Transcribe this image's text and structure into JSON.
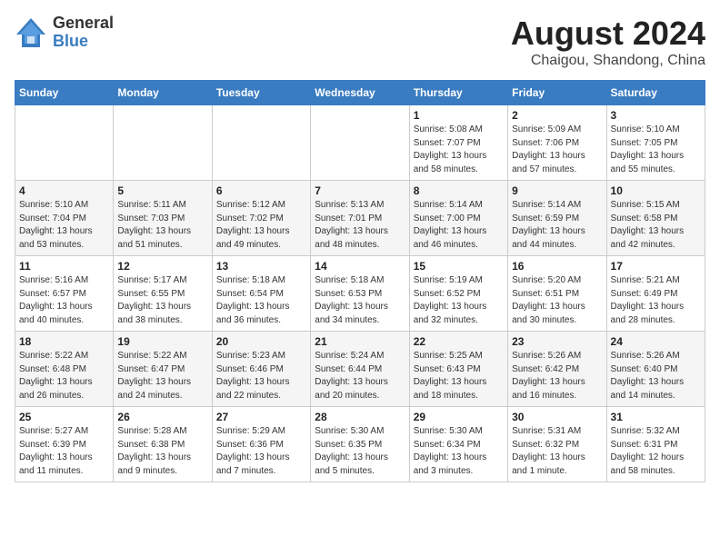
{
  "header": {
    "logo": {
      "general": "General",
      "blue": "Blue"
    },
    "title": "August 2024",
    "subtitle": "Chaigou, Shandong, China"
  },
  "weekdays": [
    "Sunday",
    "Monday",
    "Tuesday",
    "Wednesday",
    "Thursday",
    "Friday",
    "Saturday"
  ],
  "weeks": [
    [
      {
        "day": "",
        "info": ""
      },
      {
        "day": "",
        "info": ""
      },
      {
        "day": "",
        "info": ""
      },
      {
        "day": "",
        "info": ""
      },
      {
        "day": "1",
        "info": "Sunrise: 5:08 AM\nSunset: 7:07 PM\nDaylight: 13 hours\nand 58 minutes."
      },
      {
        "day": "2",
        "info": "Sunrise: 5:09 AM\nSunset: 7:06 PM\nDaylight: 13 hours\nand 57 minutes."
      },
      {
        "day": "3",
        "info": "Sunrise: 5:10 AM\nSunset: 7:05 PM\nDaylight: 13 hours\nand 55 minutes."
      }
    ],
    [
      {
        "day": "4",
        "info": "Sunrise: 5:10 AM\nSunset: 7:04 PM\nDaylight: 13 hours\nand 53 minutes."
      },
      {
        "day": "5",
        "info": "Sunrise: 5:11 AM\nSunset: 7:03 PM\nDaylight: 13 hours\nand 51 minutes."
      },
      {
        "day": "6",
        "info": "Sunrise: 5:12 AM\nSunset: 7:02 PM\nDaylight: 13 hours\nand 49 minutes."
      },
      {
        "day": "7",
        "info": "Sunrise: 5:13 AM\nSunset: 7:01 PM\nDaylight: 13 hours\nand 48 minutes."
      },
      {
        "day": "8",
        "info": "Sunrise: 5:14 AM\nSunset: 7:00 PM\nDaylight: 13 hours\nand 46 minutes."
      },
      {
        "day": "9",
        "info": "Sunrise: 5:14 AM\nSunset: 6:59 PM\nDaylight: 13 hours\nand 44 minutes."
      },
      {
        "day": "10",
        "info": "Sunrise: 5:15 AM\nSunset: 6:58 PM\nDaylight: 13 hours\nand 42 minutes."
      }
    ],
    [
      {
        "day": "11",
        "info": "Sunrise: 5:16 AM\nSunset: 6:57 PM\nDaylight: 13 hours\nand 40 minutes."
      },
      {
        "day": "12",
        "info": "Sunrise: 5:17 AM\nSunset: 6:55 PM\nDaylight: 13 hours\nand 38 minutes."
      },
      {
        "day": "13",
        "info": "Sunrise: 5:18 AM\nSunset: 6:54 PM\nDaylight: 13 hours\nand 36 minutes."
      },
      {
        "day": "14",
        "info": "Sunrise: 5:18 AM\nSunset: 6:53 PM\nDaylight: 13 hours\nand 34 minutes."
      },
      {
        "day": "15",
        "info": "Sunrise: 5:19 AM\nSunset: 6:52 PM\nDaylight: 13 hours\nand 32 minutes."
      },
      {
        "day": "16",
        "info": "Sunrise: 5:20 AM\nSunset: 6:51 PM\nDaylight: 13 hours\nand 30 minutes."
      },
      {
        "day": "17",
        "info": "Sunrise: 5:21 AM\nSunset: 6:49 PM\nDaylight: 13 hours\nand 28 minutes."
      }
    ],
    [
      {
        "day": "18",
        "info": "Sunrise: 5:22 AM\nSunset: 6:48 PM\nDaylight: 13 hours\nand 26 minutes."
      },
      {
        "day": "19",
        "info": "Sunrise: 5:22 AM\nSunset: 6:47 PM\nDaylight: 13 hours\nand 24 minutes."
      },
      {
        "day": "20",
        "info": "Sunrise: 5:23 AM\nSunset: 6:46 PM\nDaylight: 13 hours\nand 22 minutes."
      },
      {
        "day": "21",
        "info": "Sunrise: 5:24 AM\nSunset: 6:44 PM\nDaylight: 13 hours\nand 20 minutes."
      },
      {
        "day": "22",
        "info": "Sunrise: 5:25 AM\nSunset: 6:43 PM\nDaylight: 13 hours\nand 18 minutes."
      },
      {
        "day": "23",
        "info": "Sunrise: 5:26 AM\nSunset: 6:42 PM\nDaylight: 13 hours\nand 16 minutes."
      },
      {
        "day": "24",
        "info": "Sunrise: 5:26 AM\nSunset: 6:40 PM\nDaylight: 13 hours\nand 14 minutes."
      }
    ],
    [
      {
        "day": "25",
        "info": "Sunrise: 5:27 AM\nSunset: 6:39 PM\nDaylight: 13 hours\nand 11 minutes."
      },
      {
        "day": "26",
        "info": "Sunrise: 5:28 AM\nSunset: 6:38 PM\nDaylight: 13 hours\nand 9 minutes."
      },
      {
        "day": "27",
        "info": "Sunrise: 5:29 AM\nSunset: 6:36 PM\nDaylight: 13 hours\nand 7 minutes."
      },
      {
        "day": "28",
        "info": "Sunrise: 5:30 AM\nSunset: 6:35 PM\nDaylight: 13 hours\nand 5 minutes."
      },
      {
        "day": "29",
        "info": "Sunrise: 5:30 AM\nSunset: 6:34 PM\nDaylight: 13 hours\nand 3 minutes."
      },
      {
        "day": "30",
        "info": "Sunrise: 5:31 AM\nSunset: 6:32 PM\nDaylight: 13 hours\nand 1 minute."
      },
      {
        "day": "31",
        "info": "Sunrise: 5:32 AM\nSunset: 6:31 PM\nDaylight: 12 hours\nand 58 minutes."
      }
    ]
  ]
}
